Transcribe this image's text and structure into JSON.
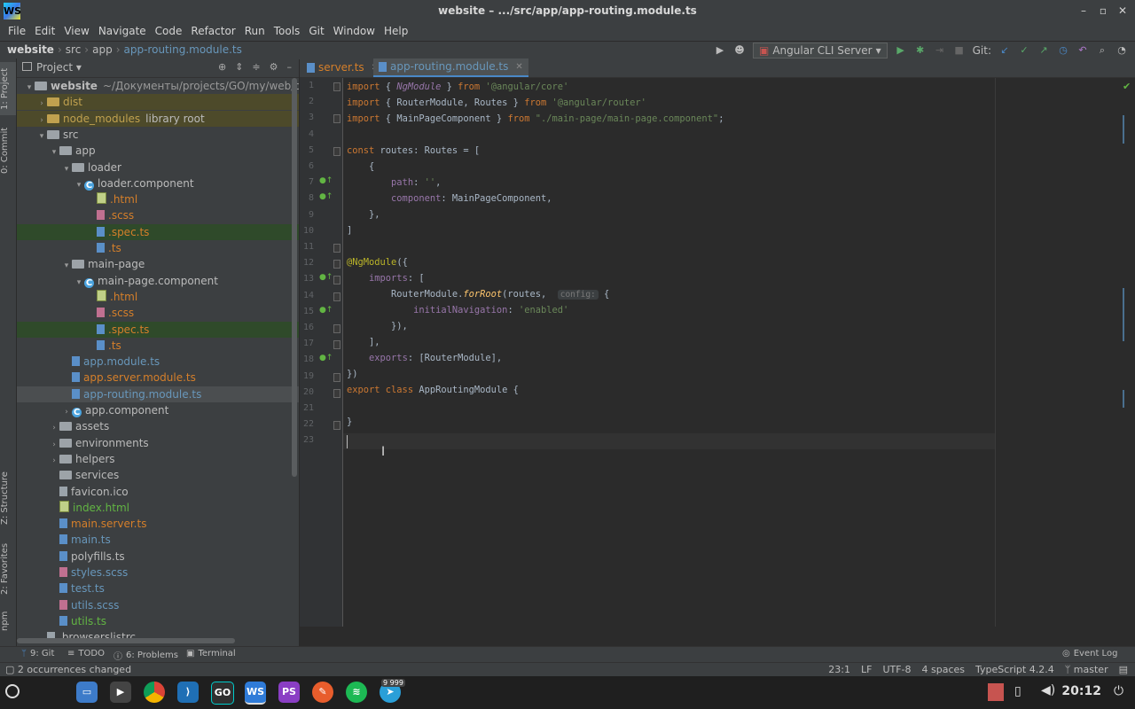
{
  "window": {
    "title": "website – .../src/app/app-routing.module.ts"
  },
  "menu": [
    "File",
    "Edit",
    "View",
    "Navigate",
    "Code",
    "Refactor",
    "Run",
    "Tools",
    "Git",
    "Window",
    "Help"
  ],
  "breadcrumb": [
    "website",
    "src",
    "app",
    "app-routing.module.ts"
  ],
  "toolbar": {
    "run_config": "Angular CLI Server",
    "git_label": "Git:"
  },
  "stripe": {
    "project": "1: Project",
    "commit": "0: Commit",
    "structure": "Z: Structure",
    "favorites": "2: Favorites",
    "npm": "npm"
  },
  "project": {
    "title": "Project",
    "rows": [
      {
        "label": "website",
        "suffix": "~/Документы/projects/GO/my/web/qbasket/se",
        "indent": 0,
        "chev": "v",
        "icon": "folder",
        "color": "#bbbbbb",
        "bold": true
      },
      {
        "label": "dist",
        "suffix": "",
        "indent": 1,
        "chev": ">",
        "icon": "folder-yellow",
        "color": "#c0a14f",
        "bg": "#4d4a2a"
      },
      {
        "label": "node_modules",
        "suffix": "library root",
        "indent": 1,
        "chev": ">",
        "icon": "folder-yellow",
        "color": "#c0a14f",
        "bg": "#4d4a2a"
      },
      {
        "label": "src",
        "suffix": "",
        "indent": 1,
        "chev": "v",
        "icon": "folder",
        "color": "#bbbbbb"
      },
      {
        "label": "app",
        "suffix": "",
        "indent": 2,
        "chev": "v",
        "icon": "folder",
        "color": "#bbbbbb"
      },
      {
        "label": "loader",
        "suffix": "",
        "indent": 3,
        "chev": "v",
        "icon": "folder",
        "color": "#bbbbbb"
      },
      {
        "label": "loader.component",
        "suffix": "",
        "indent": 4,
        "chev": "v",
        "icon": "comp",
        "color": "#bbbbbb"
      },
      {
        "label": ".html",
        "suffix": "",
        "indent": 5,
        "chev": "",
        "icon": "html",
        "color": "#d57f2a"
      },
      {
        "label": ".scss",
        "suffix": "",
        "indent": 5,
        "chev": "",
        "icon": "scss",
        "color": "#d57f2a"
      },
      {
        "label": ".spec.ts",
        "suffix": "",
        "indent": 5,
        "chev": "",
        "icon": "ts",
        "color": "#d57f2a",
        "bg": "#2f4a2a"
      },
      {
        "label": ".ts",
        "suffix": "",
        "indent": 5,
        "chev": "",
        "icon": "ts",
        "color": "#d57f2a"
      },
      {
        "label": "main-page",
        "suffix": "",
        "indent": 3,
        "chev": "v",
        "icon": "folder",
        "color": "#bbbbbb"
      },
      {
        "label": "main-page.component",
        "suffix": "",
        "indent": 4,
        "chev": "v",
        "icon": "comp",
        "color": "#bbbbbb"
      },
      {
        "label": ".html",
        "suffix": "",
        "indent": 5,
        "chev": "",
        "icon": "html",
        "color": "#d57f2a"
      },
      {
        "label": ".scss",
        "suffix": "",
        "indent": 5,
        "chev": "",
        "icon": "scss",
        "color": "#d57f2a"
      },
      {
        "label": ".spec.ts",
        "suffix": "",
        "indent": 5,
        "chev": "",
        "icon": "ts",
        "color": "#d57f2a",
        "bg": "#2f4a2a"
      },
      {
        "label": ".ts",
        "suffix": "",
        "indent": 5,
        "chev": "",
        "icon": "ts",
        "color": "#d57f2a"
      },
      {
        "label": "app.module.ts",
        "suffix": "",
        "indent": 3,
        "chev": "",
        "icon": "ts",
        "color": "#6897bb"
      },
      {
        "label": "app.server.module.ts",
        "suffix": "",
        "indent": 3,
        "chev": "",
        "icon": "ts",
        "color": "#d57f2a"
      },
      {
        "label": "app-routing.module.ts",
        "suffix": "",
        "indent": 3,
        "chev": "",
        "icon": "ts",
        "color": "#6897bb",
        "bg": "#4b4e50"
      },
      {
        "label": "app.component",
        "suffix": "",
        "indent": 3,
        "chev": ">",
        "icon": "comp",
        "color": "#bbbbbb"
      },
      {
        "label": "assets",
        "suffix": "",
        "indent": 2,
        "chev": ">",
        "icon": "folder",
        "color": "#bbbbbb"
      },
      {
        "label": "environments",
        "suffix": "",
        "indent": 2,
        "chev": ">",
        "icon": "folder",
        "color": "#bbbbbb"
      },
      {
        "label": "helpers",
        "suffix": "",
        "indent": 2,
        "chev": ">",
        "icon": "folder",
        "color": "#bbbbbb"
      },
      {
        "label": "services",
        "suffix": "",
        "indent": 2,
        "chev": "",
        "icon": "folder",
        "color": "#bbbbbb"
      },
      {
        "label": "favicon.ico",
        "suffix": "",
        "indent": 2,
        "chev": "",
        "icon": "generic",
        "color": "#bbbbbb"
      },
      {
        "label": "index.html",
        "suffix": "",
        "indent": 2,
        "chev": "",
        "icon": "html",
        "color": "#62b543"
      },
      {
        "label": "main.server.ts",
        "suffix": "",
        "indent": 2,
        "chev": "",
        "icon": "ts",
        "color": "#d57f2a"
      },
      {
        "label": "main.ts",
        "suffix": "",
        "indent": 2,
        "chev": "",
        "icon": "ts",
        "color": "#6897bb"
      },
      {
        "label": "polyfills.ts",
        "suffix": "",
        "indent": 2,
        "chev": "",
        "icon": "ts",
        "color": "#bbbbbb"
      },
      {
        "label": "styles.scss",
        "suffix": "",
        "indent": 2,
        "chev": "",
        "icon": "scss",
        "color": "#6897bb"
      },
      {
        "label": "test.ts",
        "suffix": "",
        "indent": 2,
        "chev": "",
        "icon": "ts",
        "color": "#6897bb"
      },
      {
        "label": "utils.scss",
        "suffix": "",
        "indent": 2,
        "chev": "",
        "icon": "scss",
        "color": "#6897bb"
      },
      {
        "label": "utils.ts",
        "suffix": "",
        "indent": 2,
        "chev": "",
        "icon": "ts",
        "color": "#62b543"
      },
      {
        "label": ".browserslistrc",
        "suffix": "",
        "indent": 1,
        "chev": "",
        "icon": "generic",
        "color": "#bbbbbb"
      }
    ]
  },
  "tabs": [
    {
      "label": "server.ts",
      "active": false
    },
    {
      "label": "app-routing.module.ts",
      "active": true
    }
  ],
  "code": {
    "lines": [
      "1",
      "2",
      "3",
      "4",
      "5",
      "6",
      "7",
      "8",
      "9",
      "10",
      "11",
      "12",
      "13",
      "14",
      "15",
      "16",
      "17",
      "18",
      "19",
      "20",
      "21",
      "22",
      "23"
    ],
    "hint_config": "config:"
  },
  "bottom_tools": [
    "9: Git",
    "TODO",
    "6: Problems",
    "Terminal",
    "Event Log"
  ],
  "status": {
    "message": "2 occurrences changed",
    "position": "23:1",
    "line_sep": "LF",
    "encoding": "UTF-8",
    "indent": "4 spaces",
    "language": "TypeScript 4.2.4",
    "branch": "master"
  },
  "taskbar": {
    "clock": "20:12",
    "badge": "9 999"
  }
}
